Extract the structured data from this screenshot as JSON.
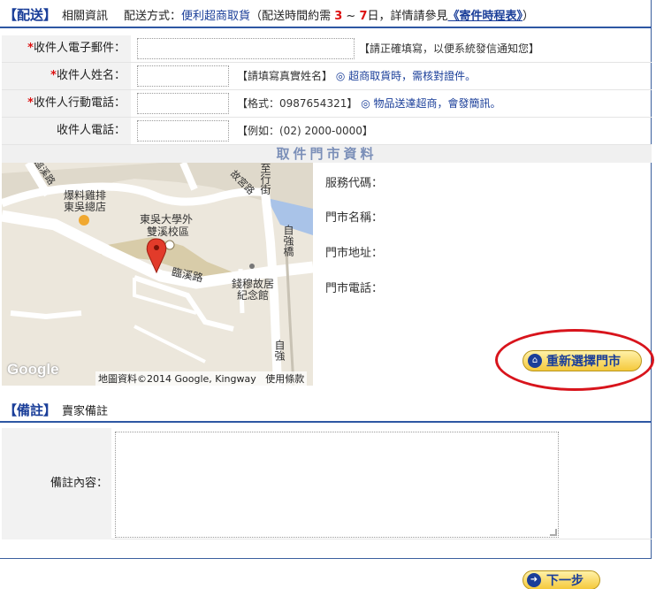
{
  "delivery": {
    "title": "【配送】",
    "subtitle": "相關資訊",
    "method_label": "配送方式：",
    "method_value": "便利超商取貨",
    "note_prefix": "（配送時間約需",
    "days_from": "3",
    "days_sep": "~",
    "days_to": "7",
    "note_mid": "日，詳情請參見",
    "schedule_link": "《寄件時程表》",
    "note_suffix": "）"
  },
  "form": {
    "required_mark": "*",
    "email_label": "收件人電子郵件：",
    "email_hint": "【請正確填寫，以便系統發信通知您】",
    "name_label": "收件人姓名：",
    "name_hint": "【請填寫真實姓名】",
    "name_note": "◎ 超商取貨時，需核對證件。",
    "mobile_label": "收件人行動電話：",
    "mobile_hint": "【格式：0987654321】",
    "mobile_note": "◎ 物品送達超商，會發簡訊。",
    "phone_label": "收件人電話：",
    "phone_hint": "【例如：(02) 2000-0000】"
  },
  "store": {
    "band_title": "取件門市資料",
    "service_code_label": "服務代碼：",
    "store_name_label": "門市名稱：",
    "store_address_label": "門市地址：",
    "store_phone_label": "門市電話：",
    "reselect_label": "重新選擇門市"
  },
  "map": {
    "labels": {
      "l1": "臨溪路",
      "l2": "爆料雞排",
      "l3": "東吳總店",
      "l4": "故宮路",
      "l5": "東吳大學外",
      "l6": "雙溪校區",
      "l7": "臨溪路",
      "l8": "錢穆故居",
      "l9": "紀念館",
      "l10": "自強橋",
      "l11": "自強",
      "l12": "至行街"
    },
    "google": "Google",
    "credit": "地圖資料©2014 Google, Kingway",
    "terms": "使用條款"
  },
  "memo": {
    "title": "【備註】",
    "subtitle": "賣家備註",
    "content_label": "備註內容："
  },
  "footer": {
    "next_label": "下一步"
  }
}
